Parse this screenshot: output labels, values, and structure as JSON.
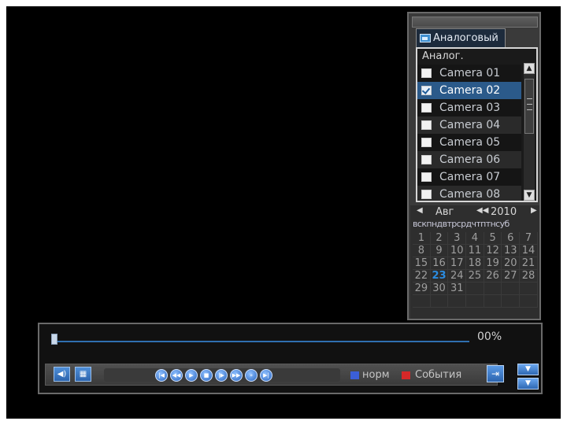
{
  "sidebar": {
    "tab_label": "Аналоговый",
    "list_header": "Аналог.",
    "cameras": [
      {
        "label": "Camera 01",
        "checked": false
      },
      {
        "label": "Camera 02",
        "checked": true
      },
      {
        "label": "Camera 03",
        "checked": false
      },
      {
        "label": "Camera 04",
        "checked": false
      },
      {
        "label": "Camera 05",
        "checked": false
      },
      {
        "label": "Camera 06",
        "checked": false
      },
      {
        "label": "Camera 07",
        "checked": false
      },
      {
        "label": "Camera 08",
        "checked": false
      }
    ],
    "selected_camera": "Camera 02",
    "scroll_up_icon": "chevron-up-icon",
    "scroll_down_icon": "chevron-down-icon"
  },
  "calendar": {
    "month": "Авг",
    "year": "2010",
    "weekdays": "вскпндвтрсрдчтптнсуб",
    "selected_day": 23,
    "days": [
      "1",
      "2",
      "3",
      "4",
      "5",
      "6",
      "7",
      "8",
      "9",
      "10",
      "11",
      "12",
      "13",
      "14",
      "15",
      "16",
      "17",
      "18",
      "19",
      "20",
      "21",
      "22",
      "23",
      "24",
      "25",
      "26",
      "27",
      "28",
      "29",
      "30",
      "31",
      "",
      "",
      "",
      "",
      "",
      "",
      "",
      "",
      "",
      "",
      ""
    ]
  },
  "playback": {
    "progress_percent": 0,
    "progress_label": "00%",
    "legend": [
      {
        "label": "норм",
        "color": "#3b5fd6"
      },
      {
        "label": "События",
        "color": "#d62828"
      }
    ],
    "transport_icons": [
      "skip-start-icon",
      "rewind-icon",
      "play-icon",
      "stop-icon",
      "step-forward-icon",
      "fast-forward-icon",
      "slow-icon",
      "skip-end-icon"
    ]
  },
  "colors": {
    "background": "#000000",
    "panel": "#3a3a3a",
    "accent_blue": "#2b5a8a",
    "today": "#2b8ce0"
  }
}
